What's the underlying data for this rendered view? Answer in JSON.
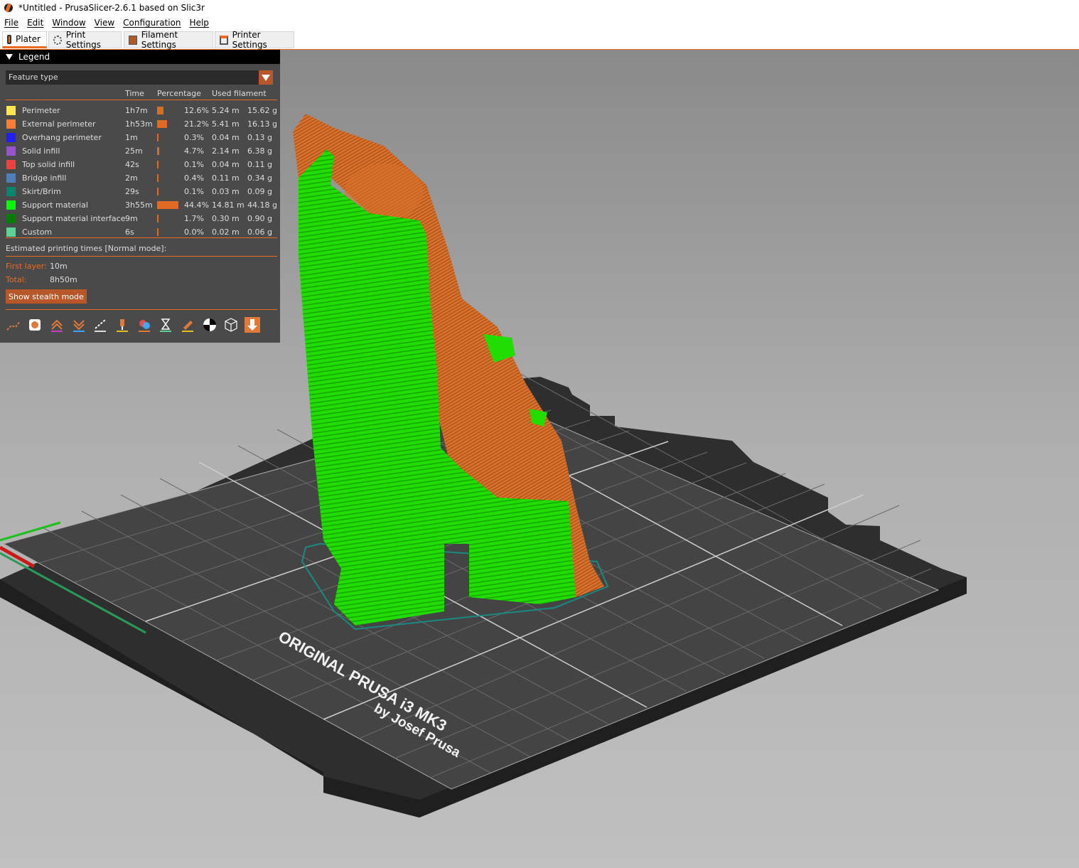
{
  "window": {
    "title": "*Untitled - PrusaSlicer-2.6.1 based on Slic3r"
  },
  "menu": [
    "File",
    "Edit",
    "Window",
    "View",
    "Configuration",
    "Help"
  ],
  "tabs": [
    {
      "label": "Plater",
      "active": true
    },
    {
      "label": "Print Settings",
      "active": false
    },
    {
      "label": "Filament Settings",
      "active": false
    },
    {
      "label": "Printer Settings",
      "active": false
    }
  ],
  "legend": {
    "title": "Legend",
    "view_type": "Feature type",
    "columns": {
      "time": "Time",
      "percentage": "Percentage",
      "filament": "Used filament"
    },
    "rows": [
      {
        "name": "Perimeter",
        "color": "#ffe64d",
        "time": "1h7m",
        "pct": "12.6%",
        "pct_value": 12.6,
        "length": "5.24 m",
        "weight": "15.62 g"
      },
      {
        "name": "External perimeter",
        "color": "#ff7d38",
        "time": "1h53m",
        "pct": "21.2%",
        "pct_value": 21.2,
        "length": "5.41 m",
        "weight": "16.13 g"
      },
      {
        "name": "Overhang perimeter",
        "color": "#1f1fff",
        "time": "1m",
        "pct": "0.3%",
        "pct_value": 0.3,
        "length": "0.04 m",
        "weight": "0.13 g"
      },
      {
        "name": "Solid infill",
        "color": "#9654cc",
        "time": "25m",
        "pct": "4.7%",
        "pct_value": 4.7,
        "length": "2.14 m",
        "weight": "6.38 g"
      },
      {
        "name": "Top solid infill",
        "color": "#f04040",
        "time": "42s",
        "pct": "0.1%",
        "pct_value": 0.1,
        "length": "0.04 m",
        "weight": "0.11 g"
      },
      {
        "name": "Bridge infill",
        "color": "#4d80ba",
        "time": "2m",
        "pct": "0.4%",
        "pct_value": 0.4,
        "length": "0.11 m",
        "weight": "0.34 g"
      },
      {
        "name": "Skirt/Brim",
        "color": "#00876e",
        "time": "29s",
        "pct": "0.1%",
        "pct_value": 0.1,
        "length": "0.03 m",
        "weight": "0.09 g"
      },
      {
        "name": "Support material",
        "color": "#00ff00",
        "time": "3h55m",
        "pct": "44.4%",
        "pct_value": 44.4,
        "length": "14.81 m",
        "weight": "44.18 g"
      },
      {
        "name": "Support material interface",
        "color": "#008000",
        "time": "9m",
        "pct": "1.7%",
        "pct_value": 1.7,
        "length": "0.30 m",
        "weight": "0.90 g"
      },
      {
        "name": "Custom",
        "color": "#5ed194",
        "time": "6s",
        "pct": "0.0%",
        "pct_value": 0.0,
        "length": "0.02 m",
        "weight": "0.06 g"
      }
    ],
    "estimated_label": "Estimated printing times [Normal mode]:",
    "first_layer_label": "First layer:",
    "first_layer_value": "10m",
    "total_label": "Total:",
    "total_value": "8h50m",
    "stealth_button": "Show stealth mode",
    "tool_icons": [
      "travel-icon",
      "wipe-icon",
      "retractions-icon",
      "deretractions-icon",
      "seams-icon",
      "tool-changes-icon",
      "color-changes-icon",
      "pause-icon",
      "custom-gcode-icon",
      "center-of-gravity-icon",
      "shells-icon",
      "tool-marker-icon"
    ]
  },
  "bed": {
    "label_line1": "ORIGINAL PRUSA i3 MK3",
    "label_line2": "by Josef Prusa"
  },
  "colors": {
    "accent": "#ed6b21",
    "panel": "#4a4a4a",
    "support": "#22dd00",
    "perimeter": "#d5702a"
  }
}
